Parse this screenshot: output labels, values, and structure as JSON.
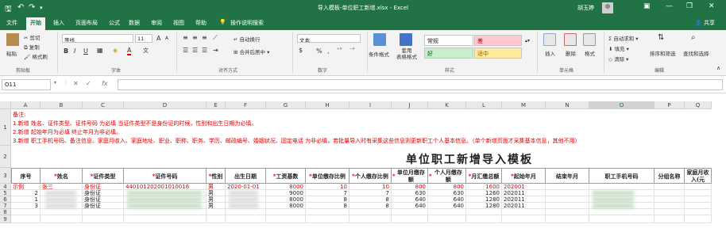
{
  "titlebar": {
    "doc_title": "导入模板-单位职工新增.xlsx - Excel",
    "user": "胡玉婷",
    "minimize": "—",
    "restore": "❐",
    "close": "✕"
  },
  "tabs": [
    "文件",
    "开始",
    "插入",
    "页面布局",
    "公式",
    "数据",
    "审阅",
    "视图",
    "帮助",
    "操作说明搜索"
  ],
  "share": "共享",
  "ribbon": {
    "clipboard": {
      "paste": "粘贴",
      "cut": "剪切",
      "copy": "复制",
      "format_painter": "格式刷",
      "label": "剪贴板"
    },
    "font": {
      "name": "等线",
      "size": "11",
      "grow": "A",
      "shrink": "A",
      "bold": "B",
      "italic": "I",
      "underline": "U",
      "font_color": "A",
      "label": "字体"
    },
    "alignment": {
      "wrap": "自动换行",
      "merge": "合并后居中",
      "label": "对齐方式"
    },
    "number": {
      "format": "文本",
      "percent": "%",
      "comma": ",",
      "label": "数字"
    },
    "styles": {
      "conditional": "条件格式",
      "table": "套用\n表格格式",
      "normal": "常规",
      "bad": "差",
      "good": "好",
      "neutral": "适中",
      "label": "样式"
    },
    "cells": {
      "insert": "插入",
      "delete": "删除",
      "format": "格式",
      "label": "单元格"
    },
    "editing": {
      "autosum": "自动求和",
      "fill": "填充",
      "clear": "清除",
      "sort": "排序和筛选",
      "find": "查找和选择",
      "label": "编辑"
    }
  },
  "formula": {
    "namebox": "O11",
    "cancel": "✕",
    "enter": "✓",
    "fx": "fx",
    "value": ""
  },
  "columns": [
    "A",
    "B",
    "C",
    "D",
    "E",
    "F",
    "G",
    "H",
    "I",
    "J",
    "K",
    "L",
    "M",
    "N",
    "O",
    "P",
    "Q"
  ],
  "rows": [
    "1",
    "2",
    "3",
    "4",
    "5",
    "6",
    "7",
    "8",
    "9"
  ],
  "notes": [
    "备注:",
    "1.新增  姓名、证件类型、证件号码 为必填  当证件类型不是身份证的时候，性别和出生日期为必填。",
    "2.新增  起始年月为必填    终止年月为非必填。",
    "3.新增  职工手机号码、备注信息、家庭月收入、家庭地址、职业、职称、职务、学历、邮政编号、婚姻状况、固定电话 为非必填，若批量导入时有采集这些信息则更新职工个人基本信息。（单个新增页面才采集基本信息，其他不用）"
  ],
  "sheet_title": "单位职工新增导入模板",
  "headers": [
    {
      "star": "",
      "text": "序号"
    },
    {
      "star": "*",
      "text": "姓名"
    },
    {
      "star": "*",
      "text": "证件类型"
    },
    {
      "star": "*",
      "text": "证件号码"
    },
    {
      "star": "*",
      "text": "性别"
    },
    {
      "star": "",
      "text": "出生日期"
    },
    {
      "star": "*",
      "text": "工资基数"
    },
    {
      "star": "*",
      "text": "单位缴存比例"
    },
    {
      "star": "*",
      "text": "个人缴存比例"
    },
    {
      "star": "*",
      "text": "单位月缴存额"
    },
    {
      "star": "*",
      "text": "个人月缴存额"
    },
    {
      "star": "*",
      "text": "月汇缴总额"
    },
    {
      "star": "*",
      "text": "起始年月"
    },
    {
      "star": "",
      "text": "结束年月"
    },
    {
      "star": "",
      "text": "职工手机号码"
    },
    {
      "star": "",
      "text": "分组名称"
    },
    {
      "star": "",
      "text": "家庭月收入(元"
    }
  ],
  "data_rows": [
    {
      "seq": "示例",
      "name": "张三",
      "id_type": "身份证",
      "id_no": "440101202001010016",
      "gender": "男",
      "birth": "2020-01-01",
      "wage": "8000",
      "unit_ratio": "10",
      "personal_ratio": "10",
      "unit_amount": "800",
      "personal_amount": "800",
      "total": "1600",
      "start": "202001",
      "example": true
    },
    {
      "seq": "2",
      "name": "",
      "id_type": "身份证",
      "id_no": "",
      "gender": "男",
      "birth": "",
      "wage": "9000",
      "unit_ratio": "7",
      "personal_ratio": "7",
      "unit_amount": "630",
      "personal_amount": "630",
      "total": "1260",
      "start": "202011",
      "example": false
    },
    {
      "seq": "1",
      "name": "",
      "id_type": "身份证",
      "id_no": "",
      "gender": "男",
      "birth": "",
      "wage": "8000",
      "unit_ratio": "8",
      "personal_ratio": "8",
      "unit_amount": "640",
      "personal_amount": "640",
      "total": "1280",
      "start": "202011",
      "example": false
    },
    {
      "seq": "3",
      "name": "",
      "id_type": "身份证",
      "id_no": "",
      "gender": "男",
      "birth": "",
      "wage": "8000",
      "unit_ratio": "8",
      "personal_ratio": "8",
      "unit_amount": "640",
      "personal_amount": "640",
      "total": "1280",
      "start": "202011",
      "example": false
    }
  ],
  "colors": {
    "excel_green": "#217346",
    "required_red": "#e00000",
    "bad_fill": "#ffc7ce",
    "good_fill": "#c6efce",
    "neutral_fill": "#ffeb9c"
  }
}
